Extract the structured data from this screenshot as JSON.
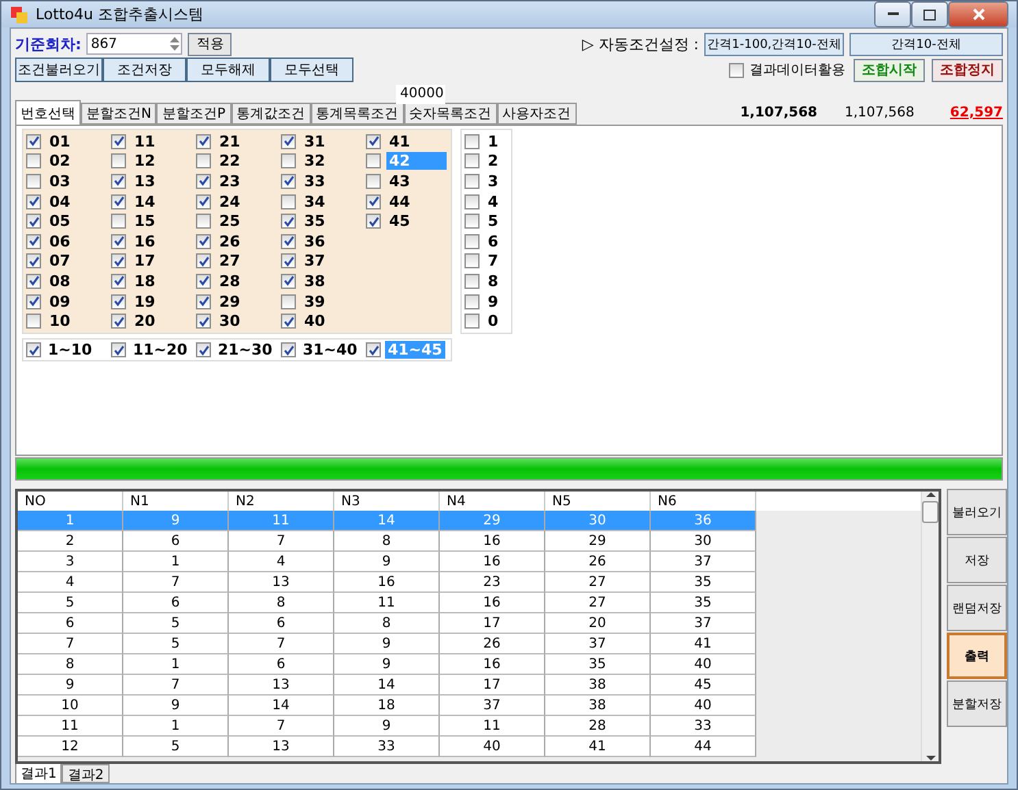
{
  "window": {
    "title": "Lotto4u 조합추출시스템"
  },
  "round": {
    "label": "기준회차:",
    "value": "867",
    "apply": "적용"
  },
  "auto_condition": {
    "label": "▷ 자동조건설정 :",
    "options": [
      "간격1-100,간격10-전체",
      "간격10-전체"
    ]
  },
  "condition_buttons": [
    "조건불러오기",
    "조건저장",
    "모두해제",
    "모두선택"
  ],
  "use_result_data": {
    "label": "결과데이터활용",
    "checked": false
  },
  "start_button": "조합시작",
  "stop_button": "조합정지",
  "limit_field": {
    "value": "40000"
  },
  "tabs": [
    {
      "label": "번호선택",
      "selected": true
    },
    {
      "label": "분할조건N",
      "selected": false
    },
    {
      "label": "분할조건P",
      "selected": false
    },
    {
      "label": "통계값조건",
      "selected": false
    },
    {
      "label": "통계목록조건",
      "selected": false
    },
    {
      "label": "숫자목록조건",
      "selected": false
    },
    {
      "label": "사용자조건",
      "selected": false
    }
  ],
  "counts": {
    "total": "1,107,568",
    "current": "1,107,568",
    "result": "62,597"
  },
  "numbers": [
    {
      "label": "01",
      "checked": true,
      "selected": false
    },
    {
      "label": "02",
      "checked": false,
      "selected": false
    },
    {
      "label": "03",
      "checked": false,
      "selected": false
    },
    {
      "label": "04",
      "checked": true,
      "selected": false
    },
    {
      "label": "05",
      "checked": true,
      "selected": false
    },
    {
      "label": "06",
      "checked": true,
      "selected": false
    },
    {
      "label": "07",
      "checked": true,
      "selected": false
    },
    {
      "label": "08",
      "checked": true,
      "selected": false
    },
    {
      "label": "09",
      "checked": true,
      "selected": false
    },
    {
      "label": "10",
      "checked": false,
      "selected": false
    },
    {
      "label": "11",
      "checked": true,
      "selected": false
    },
    {
      "label": "12",
      "checked": false,
      "selected": false
    },
    {
      "label": "13",
      "checked": true,
      "selected": false
    },
    {
      "label": "14",
      "checked": true,
      "selected": false
    },
    {
      "label": "15",
      "checked": false,
      "selected": false
    },
    {
      "label": "16",
      "checked": true,
      "selected": false
    },
    {
      "label": "17",
      "checked": true,
      "selected": false
    },
    {
      "label": "18",
      "checked": true,
      "selected": false
    },
    {
      "label": "19",
      "checked": true,
      "selected": false
    },
    {
      "label": "20",
      "checked": true,
      "selected": false
    },
    {
      "label": "21",
      "checked": true,
      "selected": false
    },
    {
      "label": "22",
      "checked": false,
      "selected": false
    },
    {
      "label": "23",
      "checked": true,
      "selected": false
    },
    {
      "label": "24",
      "checked": true,
      "selected": false
    },
    {
      "label": "25",
      "checked": false,
      "selected": false
    },
    {
      "label": "26",
      "checked": true,
      "selected": false
    },
    {
      "label": "27",
      "checked": true,
      "selected": false
    },
    {
      "label": "28",
      "checked": true,
      "selected": false
    },
    {
      "label": "29",
      "checked": true,
      "selected": false
    },
    {
      "label": "30",
      "checked": true,
      "selected": false
    },
    {
      "label": "31",
      "checked": true,
      "selected": false
    },
    {
      "label": "32",
      "checked": false,
      "selected": false
    },
    {
      "label": "33",
      "checked": true,
      "selected": false
    },
    {
      "label": "34",
      "checked": false,
      "selected": false
    },
    {
      "label": "35",
      "checked": true,
      "selected": false
    },
    {
      "label": "36",
      "checked": true,
      "selected": false
    },
    {
      "label": "37",
      "checked": true,
      "selected": false
    },
    {
      "label": "38",
      "checked": true,
      "selected": false
    },
    {
      "label": "39",
      "checked": false,
      "selected": false
    },
    {
      "label": "40",
      "checked": true,
      "selected": false
    },
    {
      "label": "41",
      "checked": true,
      "selected": false
    },
    {
      "label": "42",
      "checked": false,
      "selected": true
    },
    {
      "label": "43",
      "checked": false,
      "selected": false
    },
    {
      "label": "44",
      "checked": true,
      "selected": false
    },
    {
      "label": "45",
      "checked": true,
      "selected": false
    }
  ],
  "digits": [
    {
      "label": "1",
      "checked": false
    },
    {
      "label": "2",
      "checked": false
    },
    {
      "label": "3",
      "checked": false
    },
    {
      "label": "4",
      "checked": false
    },
    {
      "label": "5",
      "checked": false
    },
    {
      "label": "6",
      "checked": false
    },
    {
      "label": "7",
      "checked": false
    },
    {
      "label": "8",
      "checked": false
    },
    {
      "label": "9",
      "checked": false
    },
    {
      "label": "0",
      "checked": false
    }
  ],
  "ranges": [
    {
      "label": "1~10",
      "checked": true,
      "selected": false
    },
    {
      "label": "11~20",
      "checked": true,
      "selected": false
    },
    {
      "label": "21~30",
      "checked": true,
      "selected": false
    },
    {
      "label": "31~40",
      "checked": true,
      "selected": false
    },
    {
      "label": "41~45",
      "checked": true,
      "selected": true
    }
  ],
  "progress": {
    "level": 1
  },
  "table": {
    "columns": [
      "NO",
      "N1",
      "N2",
      "N3",
      "N4",
      "N5",
      "N6"
    ],
    "rows": [
      {
        "cells": [
          "1",
          "9",
          "11",
          "14",
          "29",
          "30",
          "36"
        ],
        "selected": true
      },
      {
        "cells": [
          "2",
          "6",
          "7",
          "8",
          "16",
          "29",
          "30"
        ],
        "selected": false
      },
      {
        "cells": [
          "3",
          "1",
          "4",
          "9",
          "16",
          "26",
          "37"
        ],
        "selected": false
      },
      {
        "cells": [
          "4",
          "7",
          "13",
          "16",
          "23",
          "27",
          "35"
        ],
        "selected": false
      },
      {
        "cells": [
          "5",
          "6",
          "8",
          "11",
          "16",
          "27",
          "35"
        ],
        "selected": false
      },
      {
        "cells": [
          "6",
          "5",
          "6",
          "8",
          "17",
          "20",
          "37"
        ],
        "selected": false
      },
      {
        "cells": [
          "7",
          "5",
          "7",
          "9",
          "26",
          "37",
          "41"
        ],
        "selected": false
      },
      {
        "cells": [
          "8",
          "1",
          "6",
          "9",
          "16",
          "35",
          "40"
        ],
        "selected": false
      },
      {
        "cells": [
          "9",
          "7",
          "13",
          "14",
          "17",
          "38",
          "45"
        ],
        "selected": false
      },
      {
        "cells": [
          "10",
          "9",
          "14",
          "18",
          "37",
          "38",
          "40"
        ],
        "selected": false
      },
      {
        "cells": [
          "11",
          "1",
          "7",
          "9",
          "11",
          "28",
          "33"
        ],
        "selected": false
      },
      {
        "cells": [
          "12",
          "5",
          "13",
          "33",
          "40",
          "41",
          "44"
        ],
        "selected": false
      }
    ]
  },
  "side_buttons": [
    {
      "label": "불러오기",
      "selected": false
    },
    {
      "label": "저장",
      "selected": false
    },
    {
      "label": "랜덤저장",
      "selected": false
    },
    {
      "label": "출력",
      "selected": true
    },
    {
      "label": "분할저장",
      "selected": false
    }
  ],
  "result_tabs": [
    {
      "label": "결과1",
      "selected": true
    },
    {
      "label": "결과2",
      "selected": false
    }
  ]
}
